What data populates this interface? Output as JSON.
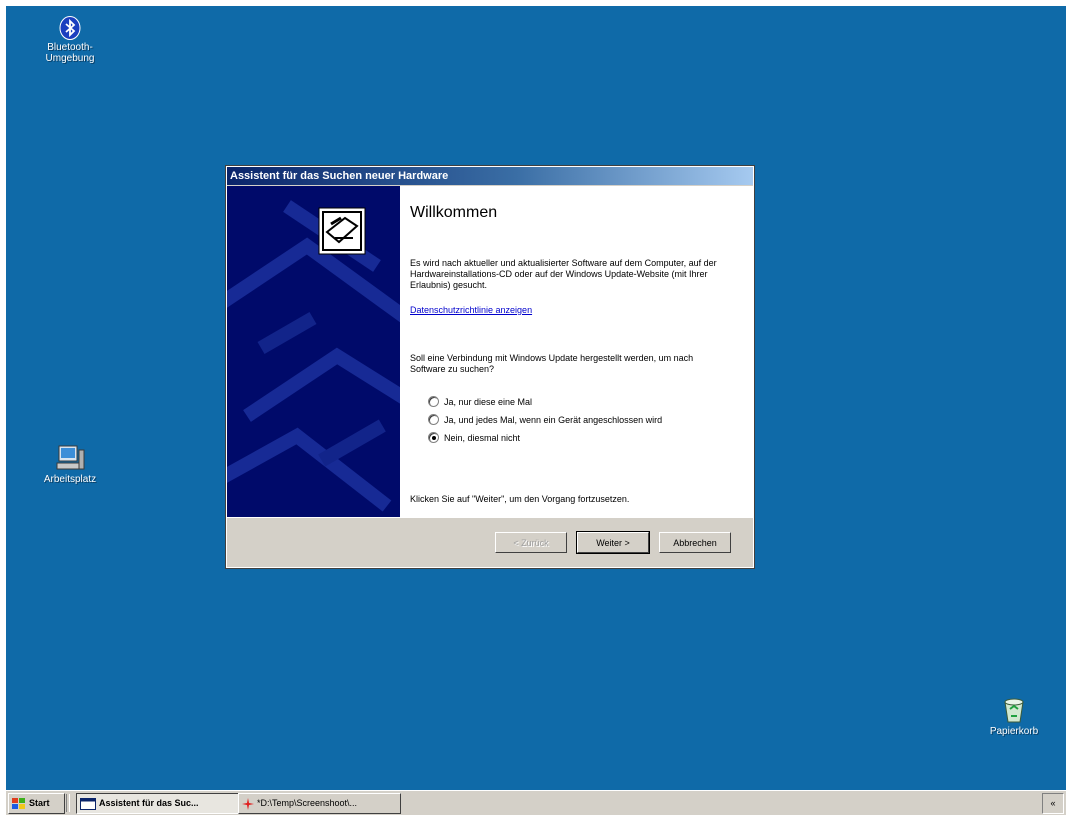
{
  "desktop": {
    "icons": [
      {
        "label": "Bluetooth-Umgebung",
        "icon": "bluetooth-icon"
      },
      {
        "label": "Arbeitsplatz",
        "icon": "computer-icon"
      },
      {
        "label": "Papierkorb",
        "icon": "recycle-bin-icon"
      }
    ]
  },
  "dialog": {
    "title": "Assistent für das Suchen neuer Hardware",
    "heading": "Willkommen",
    "intro": "Es wird nach aktueller und aktualisierter Software auf dem Computer, auf der Hardwareinstallations-CD oder auf der Windows Update-Website (mit Ihrer Erlaubnis) gesucht.",
    "privacy_link": "Datenschutzrichtlinie anzeigen",
    "question": "Soll eine Verbindung mit Windows Update hergestellt werden, um nach Software zu suchen?",
    "options": [
      {
        "label": "Ja, nur diese eine Mal",
        "checked": false
      },
      {
        "label": "Ja, und jedes Mal, wenn ein Gerät angeschlossen wird",
        "checked": false
      },
      {
        "label": "Nein, diesmal nicht",
        "checked": true
      }
    ],
    "continue_hint": "Klicken Sie auf \"Weiter\", um den Vorgang fortzusetzen.",
    "buttons": {
      "back": "< Zurück",
      "next": "Weiter >",
      "cancel": "Abbrechen"
    }
  },
  "taskbar": {
    "start": "Start",
    "tasks": [
      {
        "label": "Assistent für das Suc...",
        "active": true
      },
      {
        "label": "*D:\\Temp\\Screenshoot\\...",
        "active": false
      }
    ],
    "tray": "«"
  },
  "colors": {
    "desktop": "#0f6aa8",
    "banner": "#000a6a",
    "title_start": "#0a246a"
  }
}
